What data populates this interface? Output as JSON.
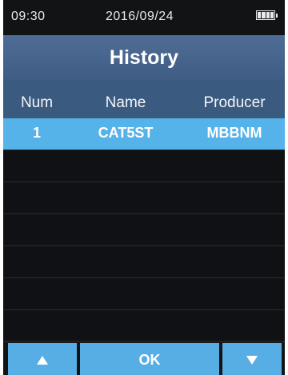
{
  "status": {
    "time": "09:30",
    "date": "2016/09/24",
    "battery_icon": "battery-full-icon"
  },
  "title": "History",
  "table": {
    "headers": [
      "Num",
      "Name",
      "Producer"
    ],
    "rows": [
      {
        "num": "1",
        "name": "CAT5ST",
        "producer": "MBBNM",
        "selected": true
      }
    ]
  },
  "footer": {
    "up_icon": "arrow-up-icon",
    "ok_label": "OK",
    "down_icon": "arrow-down-icon"
  },
  "colors": {
    "title_bar": "#46638b",
    "header_bg": "#3b5a80",
    "selected_row": "#55b3e9",
    "button_bg": "#57aee5",
    "screen_bg": "#111315"
  }
}
